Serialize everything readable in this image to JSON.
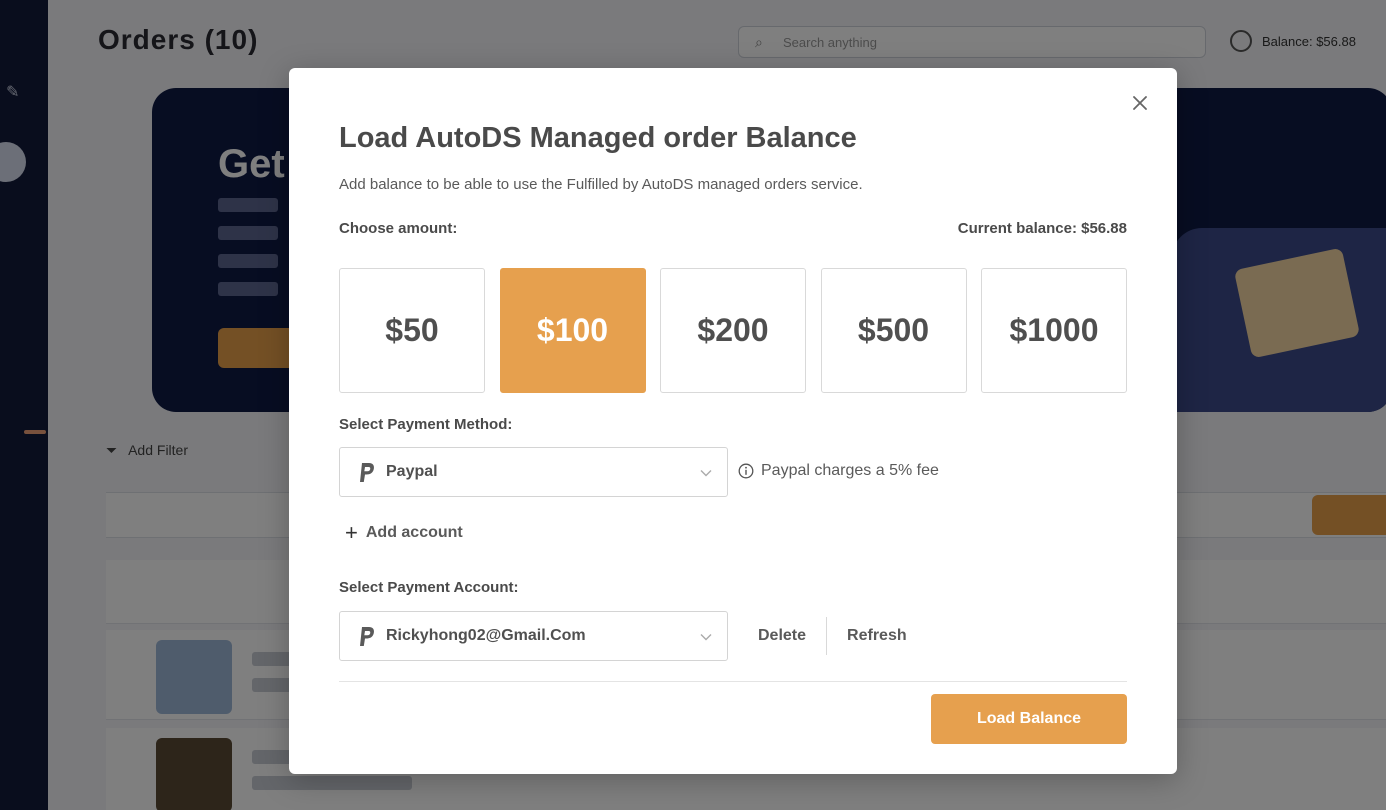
{
  "background": {
    "page_title": "Orders (10)",
    "search_placeholder": "Search anything",
    "balance_label": "Balance: $56.88"
  },
  "modal": {
    "title": "Load AutoDS Managed order Balance",
    "subtitle": "Add balance to be able to use the Fulfilled by AutoDS managed orders service.",
    "choose_amount_label": "Choose amount:",
    "current_balance": "Current balance: $56.88",
    "amounts": [
      "$50",
      "$100",
      "$200",
      "$500",
      "$1000"
    ],
    "selected_amount": "$100",
    "payment_method_label": "Select Payment Method:",
    "payment_method_value": "Paypal",
    "fee_note": "Paypal charges a 5% fee",
    "add_account_label": "Add account",
    "payment_account_label": "Select Payment Account:",
    "payment_account_value": "Rickyhong02@Gmail.Com",
    "delete_label": "Delete",
    "refresh_label": "Refresh",
    "load_button_label": "Load Balance"
  },
  "colors": {
    "accent": "#e6a04e",
    "overlay": "rgba(0,0,0,0.5)",
    "nav": "#121a3a"
  },
  "icons": [
    "close-icon",
    "paypal-icon",
    "chevron-down-icon",
    "info-icon",
    "plus-icon",
    "search-icon"
  ]
}
